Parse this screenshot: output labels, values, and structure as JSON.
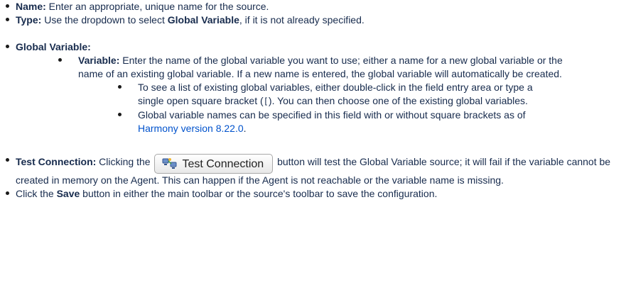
{
  "items": {
    "name": {
      "label": "Name:",
      "text": " Enter an appropriate, unique name for the source."
    },
    "type": {
      "label": "Type:",
      "text_before": " Use the dropdown to select ",
      "bold": "Global Variable",
      "text_after": ", if it is not already specified."
    },
    "global_variable": {
      "label": "Global Variable:",
      "variable": {
        "label": "Variable:",
        "text": " Enter the name of the global variable you want to use; either a name for a new global variable or the name of an existing global variable. If a new name is entered, the global variable will automatically be created."
      },
      "sub1": {
        "text_before": "To see a list of existing global variables, either double-click in the field entry area or type a single open square bracket (",
        "code": "[",
        "text_after": "). You can then choose one of the existing global variables."
      },
      "sub2": {
        "text_before": "Global variable names can be specified in this field with or without square brackets as of ",
        "link": "Harmony version 8.22.0",
        "text_after": "."
      }
    },
    "test_connection": {
      "label": "Test Connection:",
      "text_before": " Clicking the ",
      "button_label": "Test Connection",
      "text_after": " button will test the Global Variable source; it will fail if the variable cannot be created in memory on the Agent. This can happen if the Agent is not reachable or the variable name is missing."
    },
    "save": {
      "text_before": "Click the ",
      "bold": "Save",
      "text_after": " button in either the main toolbar or the source's toolbar to save the configuration."
    }
  },
  "icons": {
    "test_connection": "connection-test-icon"
  },
  "colors": {
    "text": "#172b4d",
    "link": "#0052cc"
  }
}
